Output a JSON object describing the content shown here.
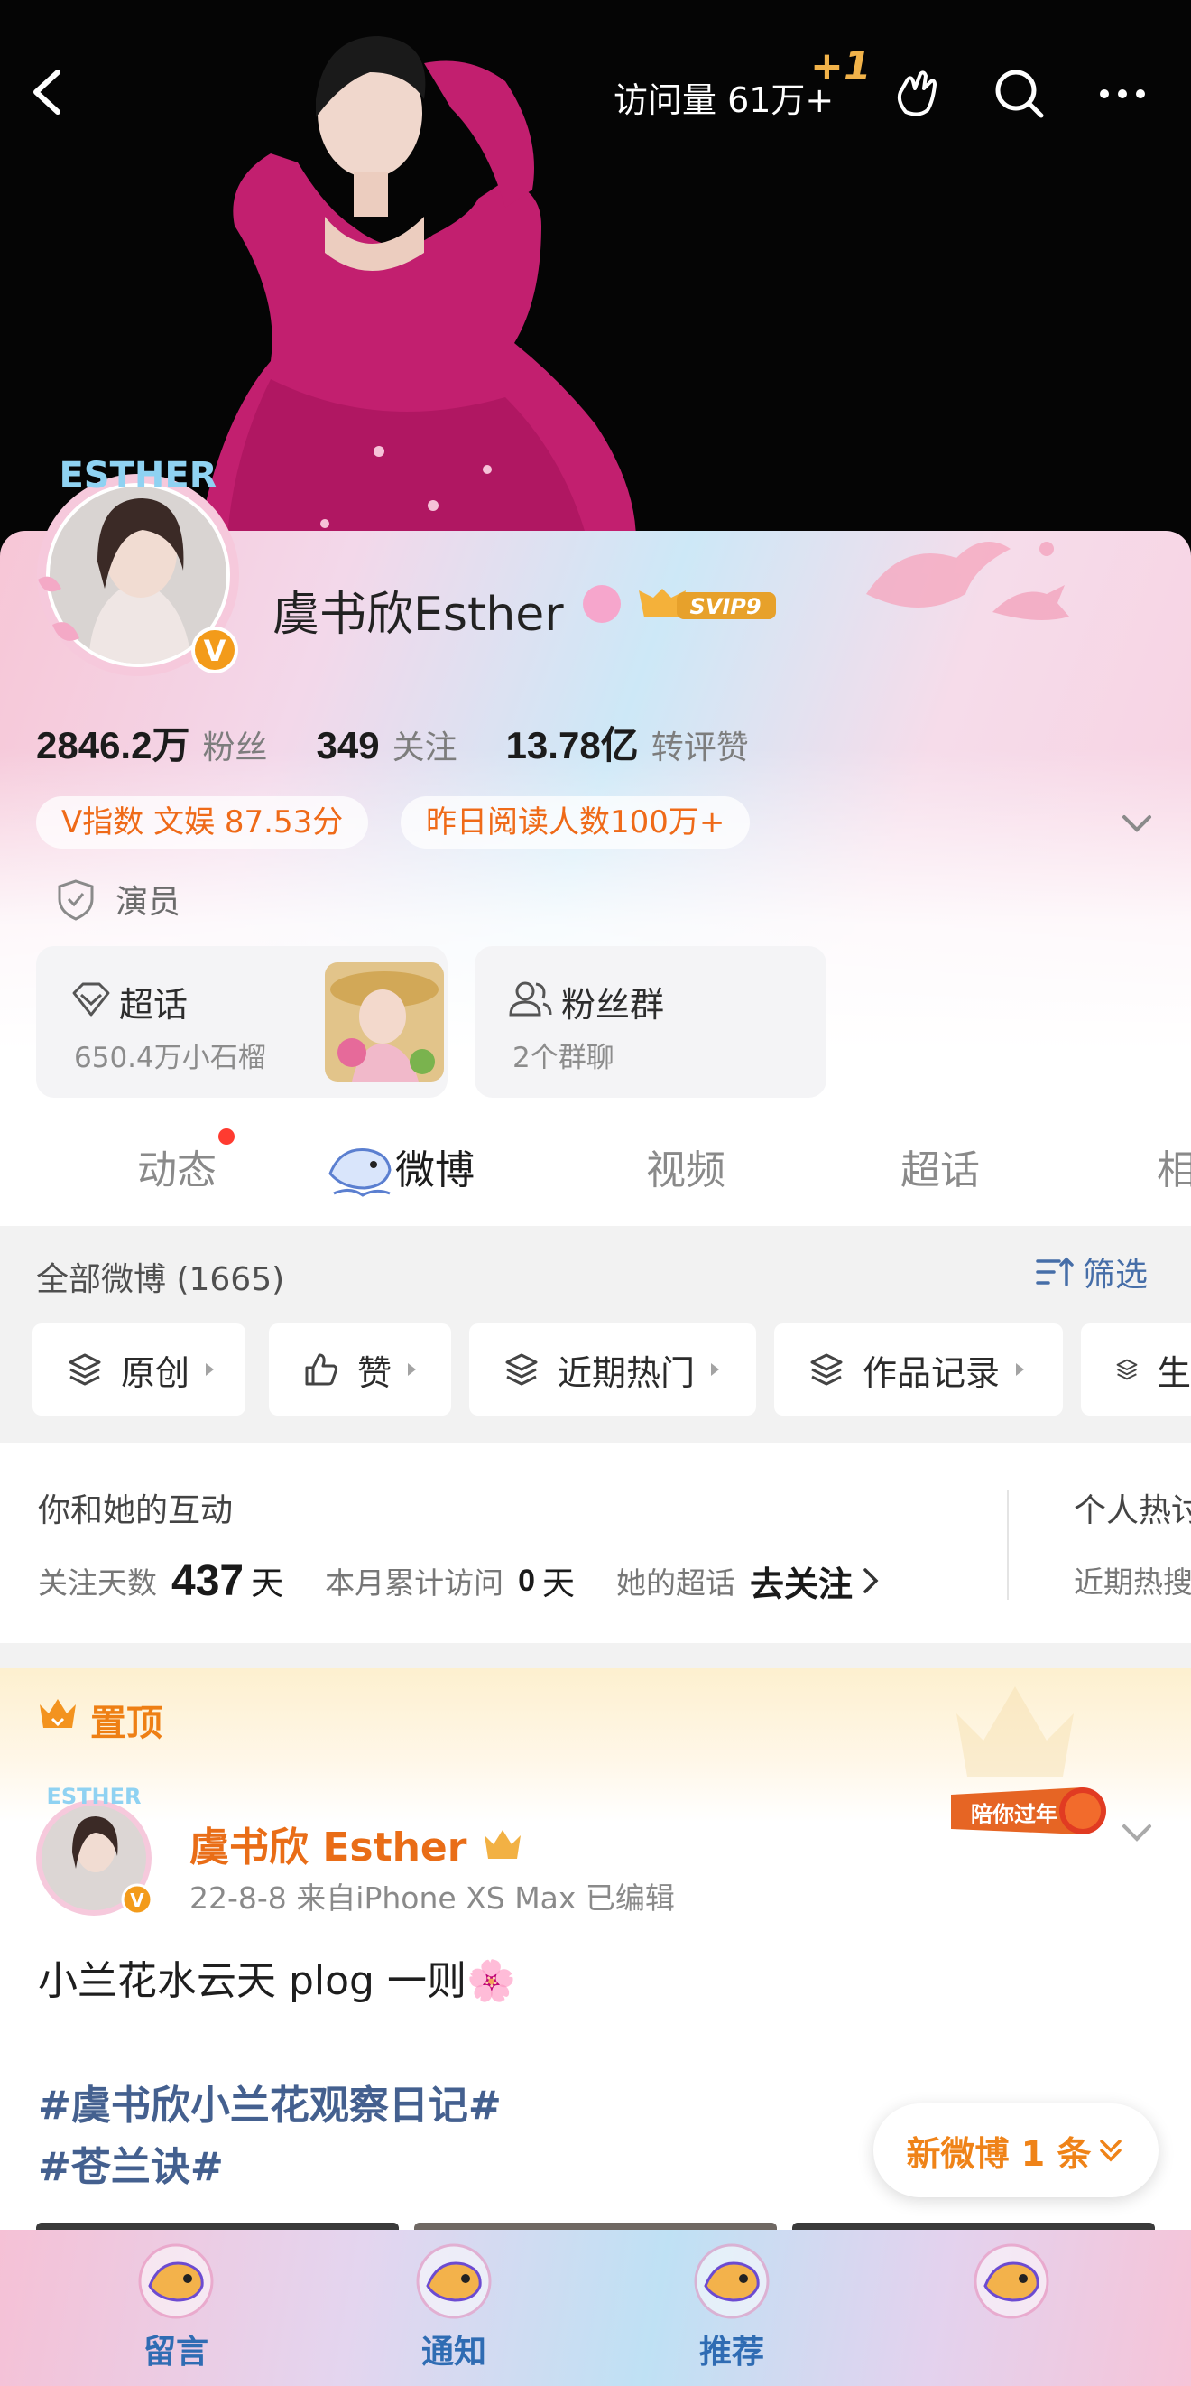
{
  "header": {
    "visits_label": "访问量 61万+",
    "visits_plus": "+1"
  },
  "profile": {
    "name": "虞书欣Esther",
    "svip": "SVIP9",
    "avatar_ring_text": "ESTHER",
    "verified_mark": "V",
    "stats": [
      {
        "value": "2846.2万",
        "label": "粉丝"
      },
      {
        "value": "349",
        "label": "关注"
      },
      {
        "value": "13.78亿",
        "label": "转评赞"
      }
    ],
    "pill_v_index": "V指数 文娱 87.53分",
    "pill_reads": "昨日阅读人数100万+",
    "role": "演员",
    "supertopic": {
      "title": "超话",
      "sub": "650.4万小石榴"
    },
    "fan_group": {
      "title": "粉丝群",
      "sub": "2个群聊"
    }
  },
  "tabs": [
    "动态",
    "微博",
    "视频",
    "超话",
    "相"
  ],
  "filters": {
    "all_count": "全部微博 (1665)",
    "filter_label": "筛选",
    "chips": [
      "原创",
      "赞",
      "近期热门",
      "作品记录",
      "生"
    ]
  },
  "interaction": {
    "title": "你和她的互动",
    "follow_days_label": "关注天数",
    "follow_days": "437",
    "days_unit": "天",
    "month_visits_label": "本月累计访问",
    "month_visits": "0",
    "her_supertopic_label": "她的超话",
    "go_follow": "去关注",
    "right_title": "个人热讨",
    "right_sub": "近期热搜"
  },
  "pinned_post": {
    "pin_label": "置顶",
    "author": "虞书欣 Esther",
    "meta": "22-8-8  来自iPhone XS Max  已编辑",
    "stamp_text": "陪你过年",
    "text": "小兰花水云天 plog 一则🌸",
    "tags": [
      "#虞书欣小兰花观察日记#",
      "#苍兰诀#"
    ],
    "new_posts": "新微博 1 条"
  },
  "bottom_nav": [
    {
      "label": "留言",
      "icon": "fish-mascot-icon"
    },
    {
      "label": "通知",
      "icon": "fish-mascot-icon"
    },
    {
      "label": "推荐",
      "icon": "fish-mascot-icon"
    },
    {
      "label": "",
      "icon": "fish-mascot-icon"
    }
  ],
  "colors": {
    "accent_orange": "#ef6a18",
    "link_blue": "#44608f",
    "filter_blue": "#466ea8",
    "dress_magenta": "#c21f6f"
  }
}
